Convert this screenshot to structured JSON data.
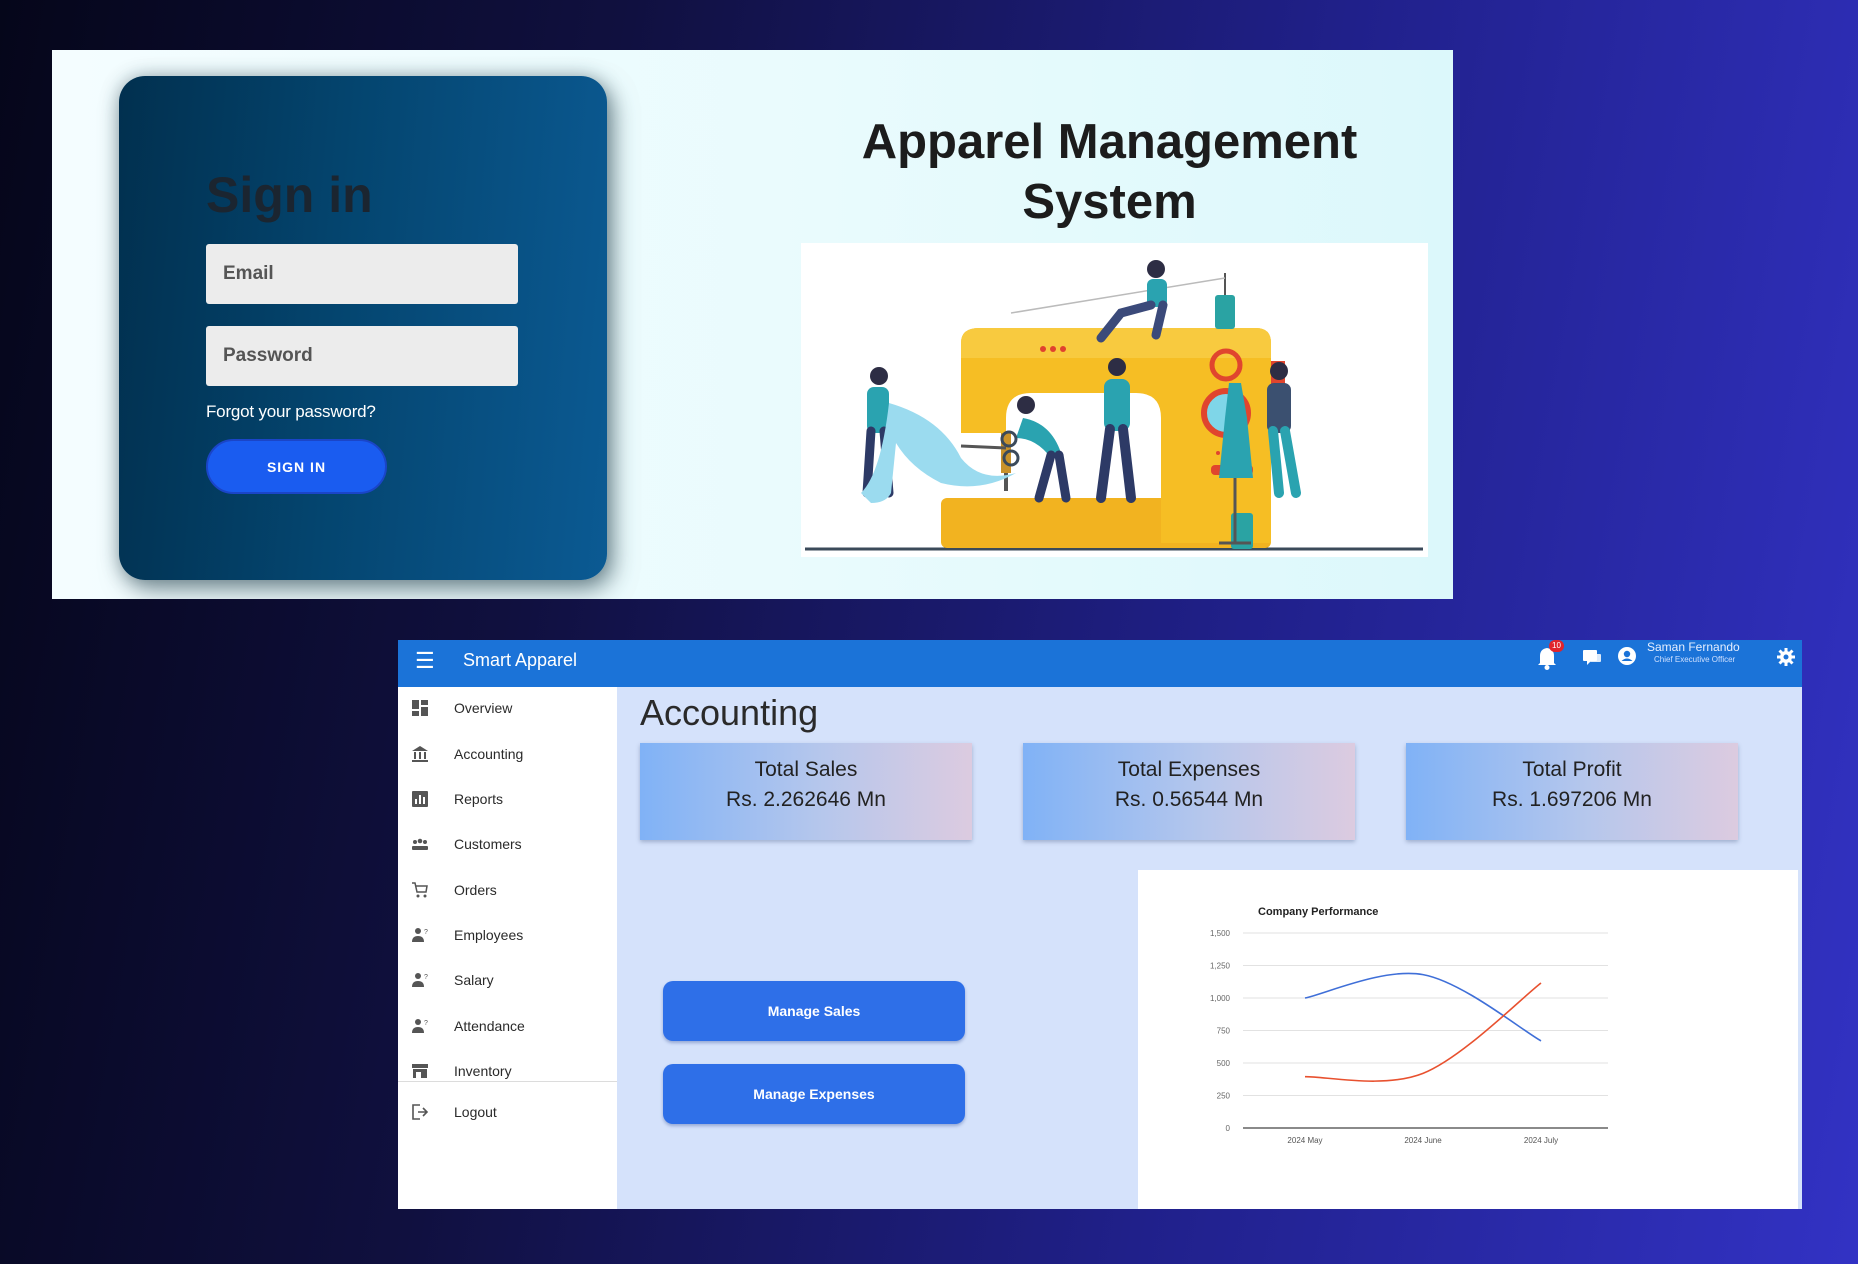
{
  "login": {
    "title": "Sign in",
    "email_placeholder": "Email",
    "password_placeholder": "Password",
    "forgot_label": "Forgot your password?",
    "signin_label": "SIGN IN",
    "heading_line1": "Apparel Management",
    "heading_line2": "System"
  },
  "dashboard": {
    "app_name": "Smart Apparel",
    "notification_count": "10",
    "user": {
      "name": "Saman Fernando",
      "role": "Chief Executive Officer"
    },
    "sidebar": {
      "items": [
        {
          "label": "Overview",
          "icon": "dashboard-icon"
        },
        {
          "label": "Accounting",
          "icon": "bank-icon"
        },
        {
          "label": "Reports",
          "icon": "report-icon"
        },
        {
          "label": "Customers",
          "icon": "people-icon"
        },
        {
          "label": "Orders",
          "icon": "cart-icon"
        },
        {
          "label": "Employees",
          "icon": "employee-icon"
        },
        {
          "label": "Salary",
          "icon": "employee-icon"
        },
        {
          "label": "Attendance",
          "icon": "employee-icon"
        },
        {
          "label": "Inventory",
          "icon": "store-icon"
        }
      ],
      "logout_label": "Logout"
    },
    "page_title": "Accounting",
    "cards": {
      "sales": {
        "label": "Total Sales",
        "value": "Rs. 2.262646 Mn"
      },
      "expenses": {
        "label": "Total Expenses",
        "value": "Rs. 0.56544 Mn"
      },
      "profit": {
        "label": "Total Profit",
        "value": "Rs. 1.697206 Mn"
      }
    },
    "buttons": {
      "manage_sales": "Manage Sales",
      "manage_expenses": "Manage Expenses"
    }
  },
  "colors": {
    "topbar": "#1b73d8",
    "sales_line": "#3f6fd8",
    "expenses_line": "#e8512f",
    "button": "#2e6fe8"
  },
  "chart_data": {
    "type": "line",
    "title": "Company Performance",
    "categories": [
      "2024 May",
      "2024 June",
      "2024 July"
    ],
    "yticks": [
      "0",
      "250",
      "500",
      "750",
      "1,000",
      "1,250",
      "1,500"
    ],
    "ylim": [
      0,
      1500
    ],
    "grid": true,
    "series": [
      {
        "values": [
          1000,
          1180,
          670
        ],
        "color": "#3f6fd8"
      },
      {
        "values": [
          395,
          420,
          1115
        ],
        "color": "#e8512f"
      }
    ]
  }
}
